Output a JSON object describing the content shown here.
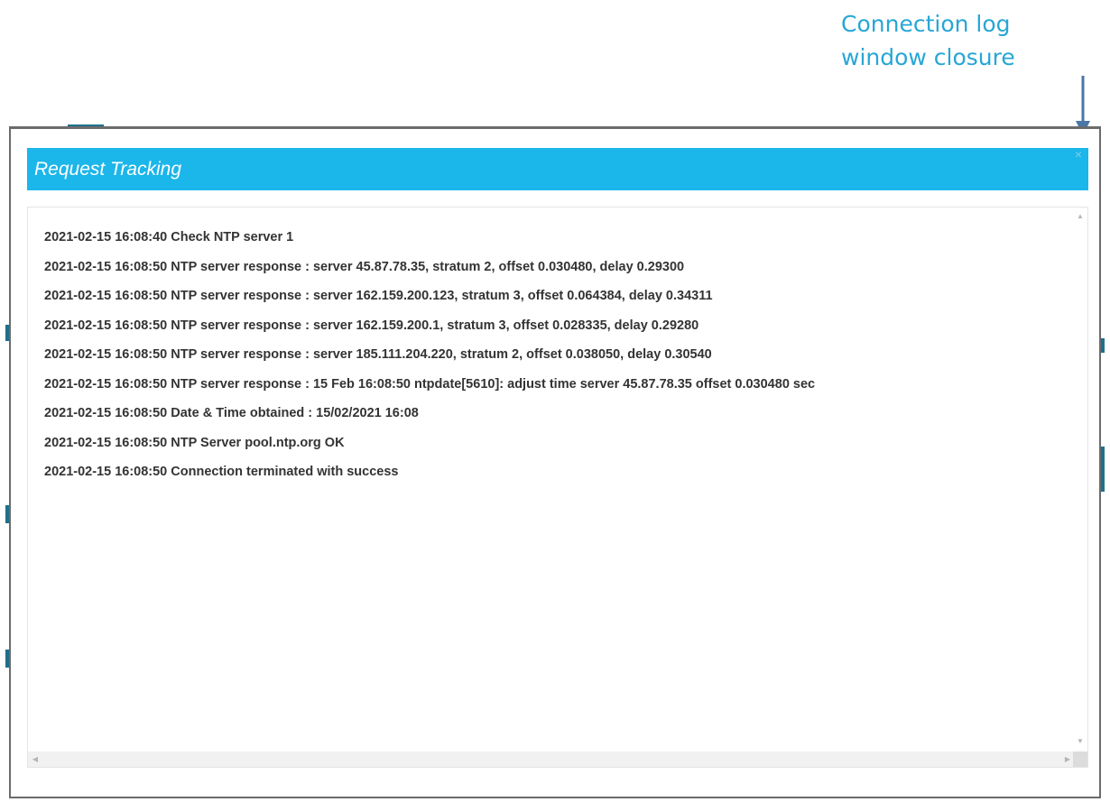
{
  "annotation": {
    "line1": "Connection log",
    "line2": "window closure",
    "color": "#27a6d6"
  },
  "dialog": {
    "title": "Request Tracking",
    "header_color": "#1bb6ea",
    "close_icon": "close-icon",
    "close_glyph": "×"
  },
  "log": {
    "lines": [
      "2021-02-15 16:08:40 Check NTP server 1",
      "2021-02-15 16:08:50 NTP server response : server 45.87.78.35, stratum 2, offset 0.030480, delay 0.29300",
      "2021-02-15 16:08:50 NTP server response : server 162.159.200.123, stratum 3, offset 0.064384, delay 0.34311",
      "2021-02-15 16:08:50 NTP server response : server 162.159.200.1, stratum 3, offset 0.028335, delay 0.29280",
      "2021-02-15 16:08:50 NTP server response : server 185.111.204.220, stratum 2, offset 0.038050, delay 0.30540",
      "2021-02-15 16:08:50 NTP server response : 15 Feb 16:08:50 ntpdate[5610]: adjust time server 45.87.78.35 offset 0.030480 sec",
      "2021-02-15 16:08:50 Date & Time obtained : 15/02/2021 16:08",
      "2021-02-15 16:08:50 NTP Server pool.ntp.org OK",
      "2021-02-15 16:08:50 Connection terminated with success"
    ]
  },
  "scrollbar": {
    "up_glyph": "▲",
    "down_glyph": "▼",
    "left_glyph": "◀",
    "right_glyph": "▶"
  }
}
